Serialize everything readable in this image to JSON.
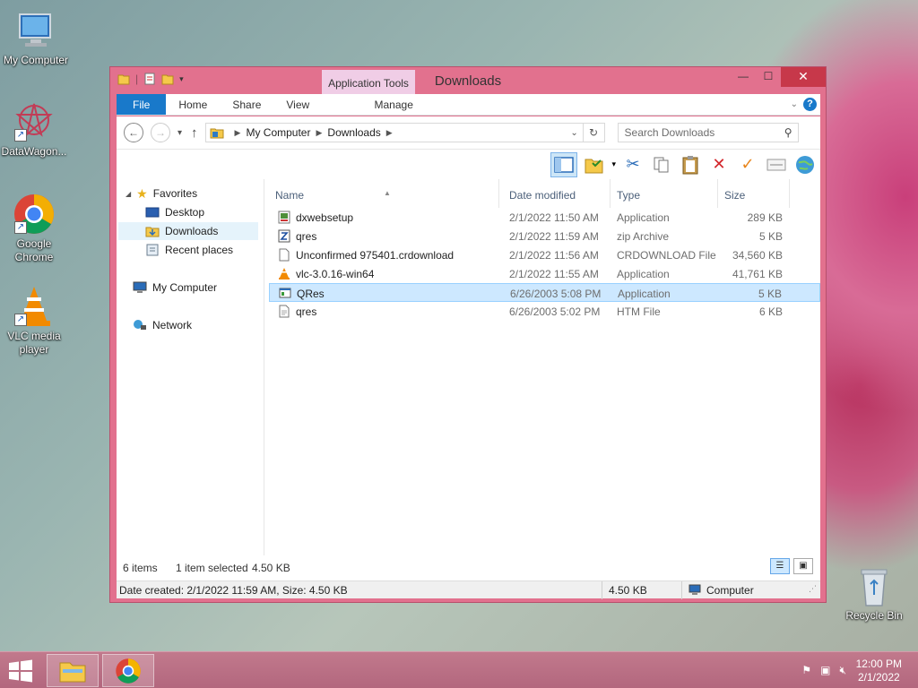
{
  "desktop": {
    "icons": [
      {
        "label": "My Computer"
      },
      {
        "label": "DataWagon..."
      },
      {
        "label": "Google Chrome"
      },
      {
        "label": "VLC media player"
      },
      {
        "label": "Recycle Bin"
      }
    ]
  },
  "window": {
    "title": "Downloads",
    "contextual_tab": "Application Tools",
    "controls": {
      "minimize": "—",
      "maximize": "☐",
      "close": "✕"
    }
  },
  "ribbon": {
    "tabs": [
      "File",
      "Home",
      "Share",
      "View",
      "Manage"
    ]
  },
  "address": {
    "segments": [
      "My Computer",
      "Downloads"
    ],
    "search_placeholder": "Search Downloads"
  },
  "navpane": {
    "favorites": "Favorites",
    "desktop": "Desktop",
    "downloads": "Downloads",
    "recent": "Recent places",
    "computer": "My Computer",
    "network": "Network"
  },
  "columns": {
    "name": "Name",
    "date": "Date modified",
    "type": "Type",
    "size": "Size"
  },
  "files": [
    {
      "name": "dxwebsetup",
      "date": "2/1/2022 11:50 AM",
      "type": "Application",
      "size": "289 KB",
      "icon": "installer-icon"
    },
    {
      "name": "qres",
      "date": "2/1/2022 11:59 AM",
      "type": "zip Archive",
      "size": "5 KB",
      "icon": "zip-icon"
    },
    {
      "name": "Unconfirmed 975401.crdownload",
      "date": "2/1/2022 11:56 AM",
      "type": "CRDOWNLOAD File",
      "size": "34,560 KB",
      "icon": "file-icon"
    },
    {
      "name": "vlc-3.0.16-win64",
      "date": "2/1/2022 11:55 AM",
      "type": "Application",
      "size": "41,761 KB",
      "icon": "vlc-icon"
    },
    {
      "name": "QRes",
      "date": "6/26/2003 5:08 PM",
      "type": "Application",
      "size": "5 KB",
      "icon": "app-icon",
      "selected": true
    },
    {
      "name": "qres",
      "date": "6/26/2003 5:02 PM",
      "type": "HTM File",
      "size": "6 KB",
      "icon": "htm-icon"
    }
  ],
  "status": {
    "count": "6 items",
    "selected": "1 item selected",
    "selected_size": "4.50 KB"
  },
  "statusbar": {
    "details": "Date created: 2/1/2022 11:59 AM, Size: 4.50 KB",
    "size": "4.50 KB",
    "location": "Computer"
  },
  "taskbar": {
    "time": "12:00 PM",
    "date": "2/1/2022"
  },
  "colors": {
    "window_frame": "#e2718e",
    "accent": "#1979ca",
    "selection": "#cde8ff",
    "taskbar": "#b8697f"
  }
}
